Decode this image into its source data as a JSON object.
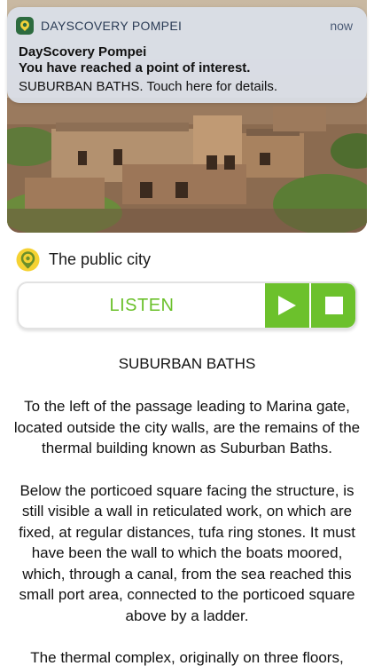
{
  "notification": {
    "app_name": "DAYSCOVERY POMPEI",
    "time": "now",
    "title": "DayScovery Pompei",
    "subtitle": "You have reached a point of interest.",
    "body": "SUBURBAN BATHS. Touch here for details."
  },
  "category": {
    "label": "The public city",
    "icon": "location-pin-icon"
  },
  "player": {
    "listen_label": "LISTEN",
    "play_icon": "play-icon",
    "stop_icon": "stop-icon",
    "accent_color": "#6cc12c"
  },
  "article": {
    "title": "SUBURBAN BATHS",
    "paragraphs": [
      "To the left of the passage leading to Marina gate, located outside the city walls, are the remains of the thermal building known as Suburban Baths.",
      "Below the porticoed square facing the structure, is still visible a wall in reticulated work, on which are fixed, at regular distances, tufa ring stones. It must have been the wall to which the boats moored, which, through a canal, from the sea reached this small port area, connected to the porticoed square above by a ladder.",
      "The thermal complex, originally on three floors,"
    ]
  }
}
